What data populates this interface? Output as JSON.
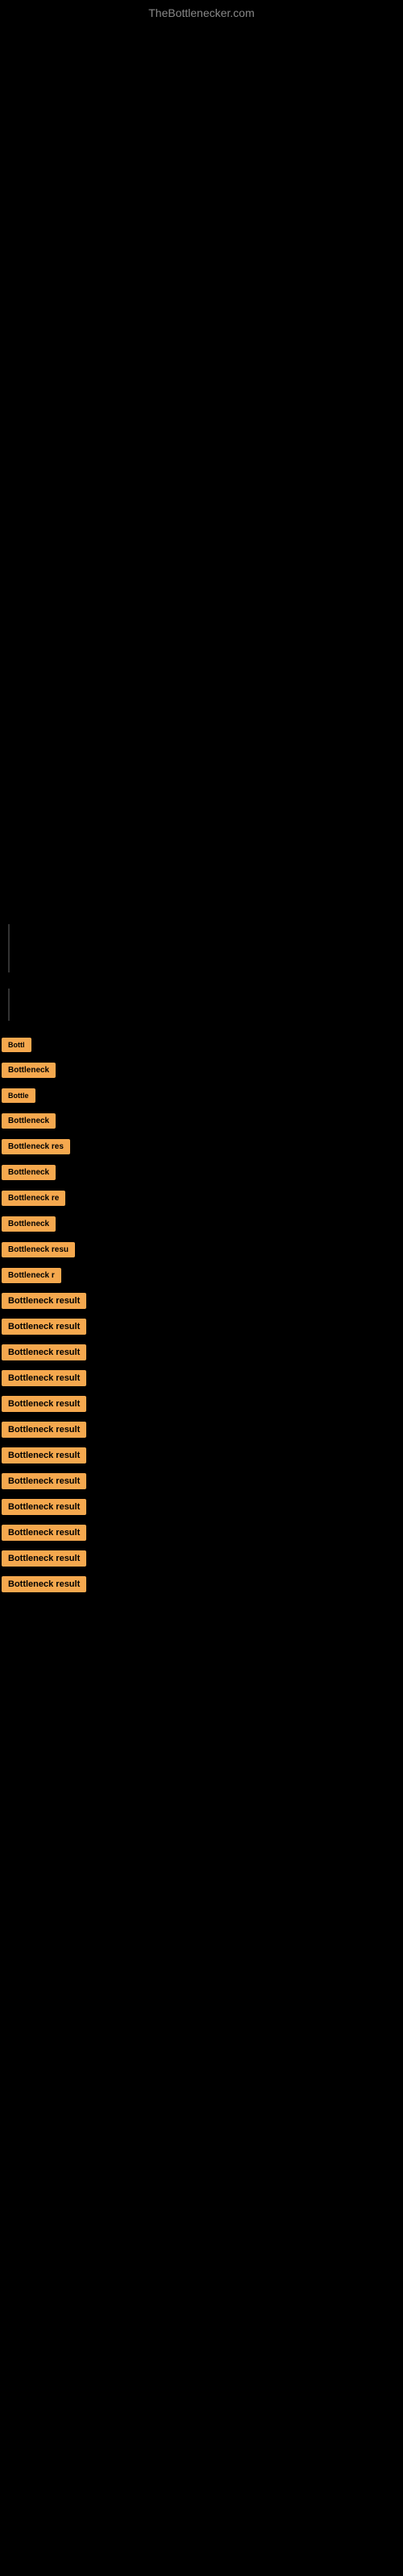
{
  "site": {
    "title": "TheBottlenecker.com"
  },
  "results": [
    {
      "id": 1,
      "label": "Bottl",
      "size": "tiny"
    },
    {
      "id": 2,
      "label": "Bottleneck",
      "size": "small"
    },
    {
      "id": 3,
      "label": "Bottle",
      "size": "tiny"
    },
    {
      "id": 4,
      "label": "Bottleneck",
      "size": "small"
    },
    {
      "id": 5,
      "label": "Bottleneck res",
      "size": "small"
    },
    {
      "id": 6,
      "label": "Bottleneck",
      "size": "small"
    },
    {
      "id": 7,
      "label": "Bottleneck re",
      "size": "small"
    },
    {
      "id": 8,
      "label": "Bottleneck",
      "size": "small"
    },
    {
      "id": 9,
      "label": "Bottleneck resu",
      "size": "small"
    },
    {
      "id": 10,
      "label": "Bottleneck r",
      "size": "small"
    },
    {
      "id": 11,
      "label": "Bottleneck result",
      "size": "normal"
    },
    {
      "id": 12,
      "label": "Bottleneck result",
      "size": "normal"
    },
    {
      "id": 13,
      "label": "Bottleneck result",
      "size": "normal"
    },
    {
      "id": 14,
      "label": "Bottleneck result",
      "size": "normal"
    },
    {
      "id": 15,
      "label": "Bottleneck result",
      "size": "normal"
    },
    {
      "id": 16,
      "label": "Bottleneck result",
      "size": "normal"
    },
    {
      "id": 17,
      "label": "Bottleneck result",
      "size": "normal"
    },
    {
      "id": 18,
      "label": "Bottleneck result",
      "size": "normal"
    },
    {
      "id": 19,
      "label": "Bottleneck result",
      "size": "normal"
    },
    {
      "id": 20,
      "label": "Bottleneck result",
      "size": "normal"
    },
    {
      "id": 21,
      "label": "Bottleneck result",
      "size": "normal"
    },
    {
      "id": 22,
      "label": "Bottleneck result",
      "size": "normal"
    }
  ]
}
